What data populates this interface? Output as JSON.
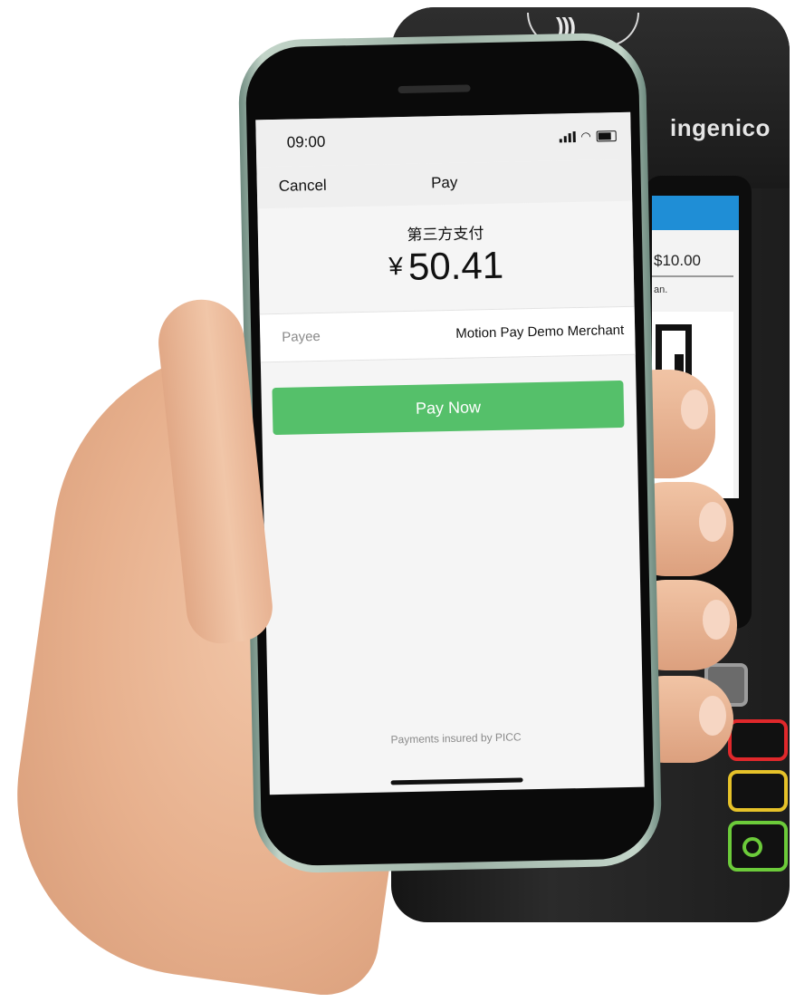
{
  "terminal": {
    "brand": "ingenico",
    "screen_amount": "$10.00",
    "screen_note": "an."
  },
  "phone": {
    "status": {
      "time": "09:00"
    },
    "nav": {
      "cancel_label": "Cancel",
      "title": "Pay"
    },
    "payment": {
      "merchant_type": "第三方支付",
      "currency_symbol": "¥",
      "amount": "50.41"
    },
    "payee": {
      "label": "Payee",
      "value": "Motion Pay Demo Merchant"
    },
    "pay_button_label": "Pay Now",
    "footer_note": "Payments insured by PICC"
  },
  "colors": {
    "pay_button": "#55c06a",
    "terminal_header": "#1f8ed6",
    "key_red": "#e0282b",
    "key_yellow": "#e6c229",
    "key_green": "#6ccb3a"
  }
}
